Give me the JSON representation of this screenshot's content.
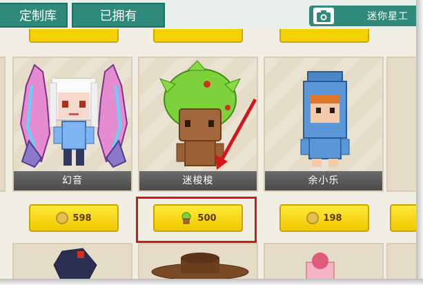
{
  "tabs": [
    {
      "label": "定制库"
    },
    {
      "label": "已拥有"
    }
  ],
  "camera_button": {
    "label": "迷你星工",
    "icon": "camera-icon"
  },
  "items": [
    {
      "name": "幻音",
      "price": "598",
      "currency_icon": "coin-icon"
    },
    {
      "name": "迷梭梭",
      "price": "500",
      "currency_icon": "leaf-icon"
    },
    {
      "name": "余小乐",
      "price": "198",
      "currency_icon": "coin-icon"
    }
  ],
  "colors": {
    "tab": "#2f8a7c",
    "price_button": "#f4d200",
    "highlight": "#d3171b"
  }
}
